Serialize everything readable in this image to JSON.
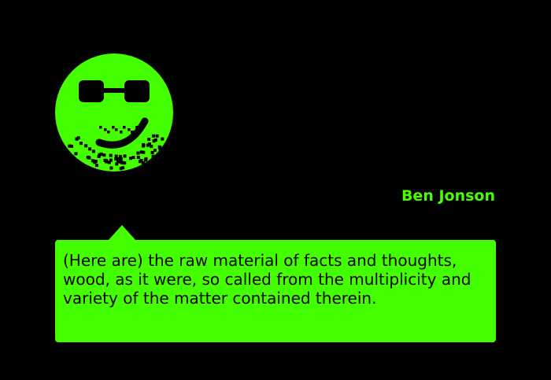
{
  "colors": {
    "background": "#000000",
    "accent": "#44ff00",
    "text_on_accent": "#000000"
  },
  "avatar": {
    "icon": "smiley-sunglasses-icon"
  },
  "quote": {
    "author": "Ben Jonson",
    "text": "(Here are) the raw material of facts and thoughts, wood, as it were, so called from the multiplicity and variety of the matter contained therein."
  }
}
